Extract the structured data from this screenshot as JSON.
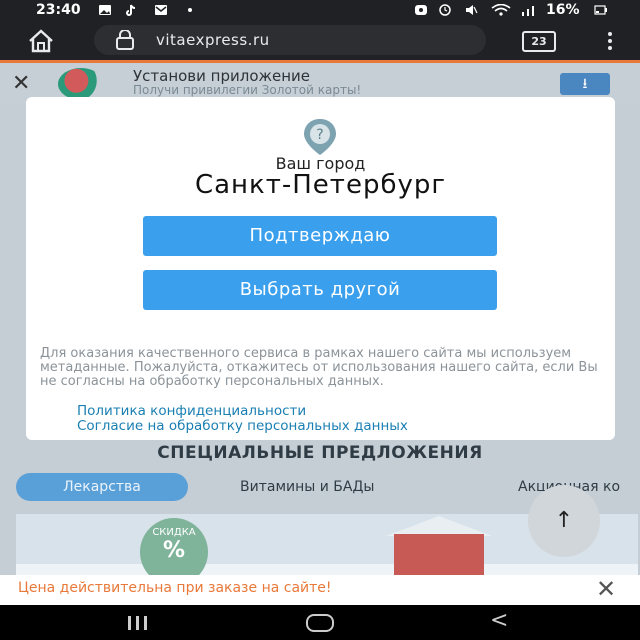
{
  "status_bar": {
    "time": "23:40",
    "battery": "16%"
  },
  "browser": {
    "url": "vitaexpress.ru",
    "tab_count": "23"
  },
  "app_banner": {
    "title": "Установи приложение",
    "subtitle": "Получи привилегии Золотой карты!"
  },
  "modal": {
    "city_label": "Ваш город",
    "city_name": "Санкт-Петербург",
    "confirm_button": "Подтверждаю",
    "choose_button": "Выбрать другой",
    "consent_text": "Для оказания качественного сервиса в рамках нашего сайта мы используем метаданные. Пожалуйста, откажитесь от использования нашего сайта, если Вы не согласны на обработку персональных данных.",
    "privacy_link": "Политика конфиденциальности",
    "consent_link": "Согласие на обработку персональных данных"
  },
  "page": {
    "section_title": "СПЕЦИАЛЬНЫЕ ПРЕДЛОЖЕНИЯ",
    "tabs": [
      "Лекарства",
      "Витамины и БАДы",
      "Акционная ко"
    ],
    "promo_badge_label": "СКИДКА",
    "promo_badge_symbol": "%"
  },
  "bottom_banner": {
    "text": "Цена действительна при заказе на сайте!"
  },
  "colors": {
    "accent_blue": "#3aa0ee",
    "link": "#1a7fb2",
    "warning_orange": "#e8793a"
  }
}
